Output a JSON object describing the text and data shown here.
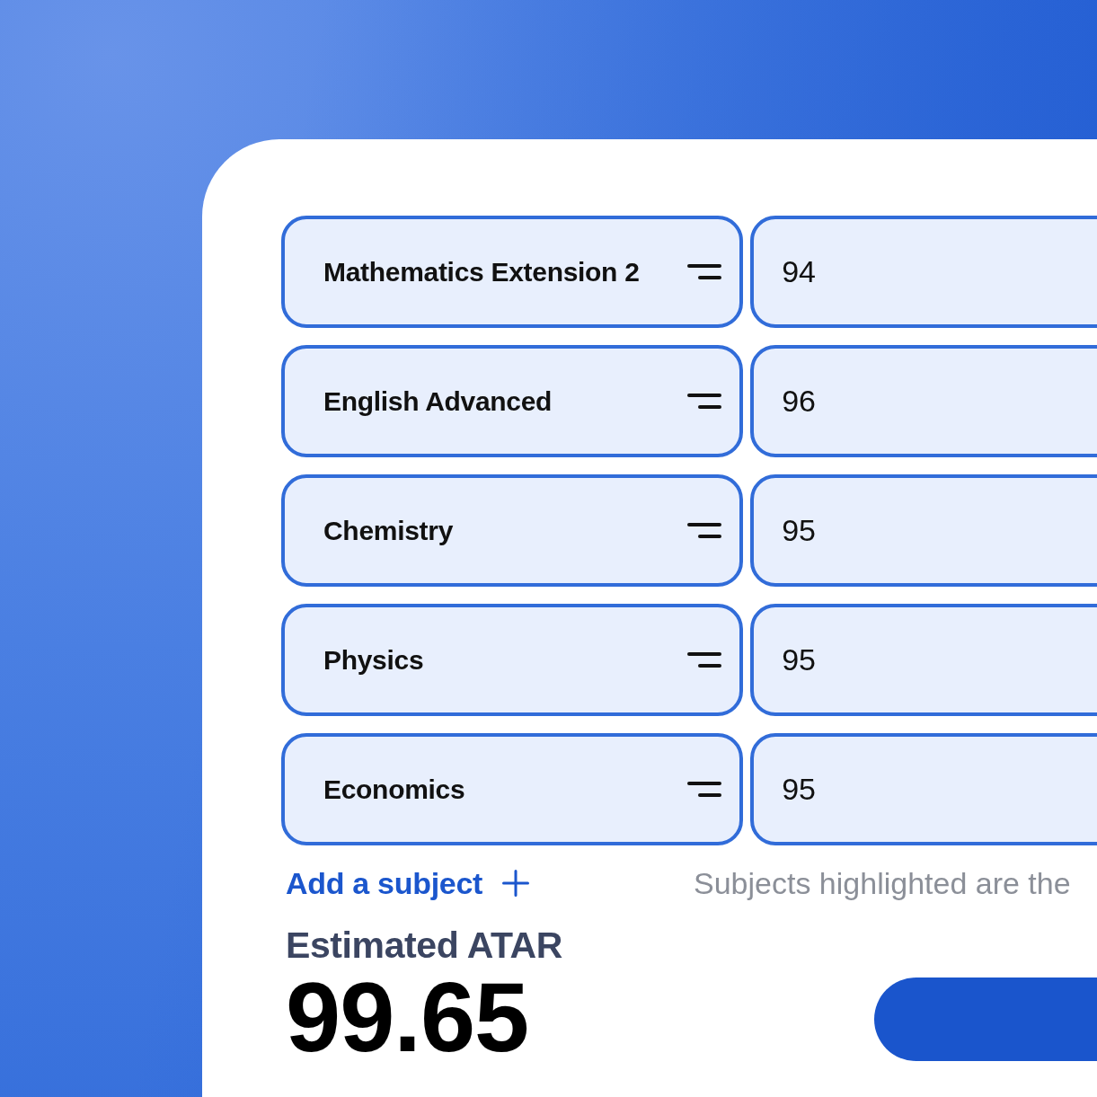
{
  "subjects": [
    {
      "name": "Mathematics Extension 2",
      "score": "94"
    },
    {
      "name": "English Advanced",
      "score": "96"
    },
    {
      "name": "Chemistry",
      "score": "95"
    },
    {
      "name": "Physics",
      "score": "95"
    },
    {
      "name": "Economics",
      "score": "95"
    }
  ],
  "add_subject": {
    "label": "Add a subject"
  },
  "hint": "Subjects highlighted are the",
  "result": {
    "label": "Estimated ATAR",
    "value": "99.65"
  }
}
